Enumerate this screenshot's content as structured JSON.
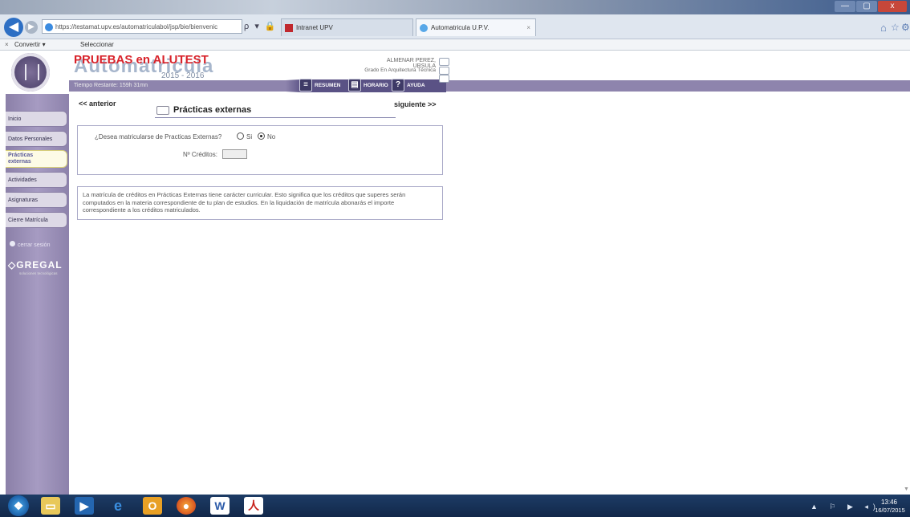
{
  "browser": {
    "url": "https://testamat.upv.es/automatriculabol/jsp/bie/bienvenic",
    "url_actions": "ρ ▾ 🔒 ↻",
    "tabs": [
      {
        "label": "Intranet UPV"
      },
      {
        "label": "Automatricula U.P.V.",
        "close": "×"
      }
    ],
    "command_bar": {
      "close": "×",
      "convert": "Convertir ▾",
      "select": "Seleccionar"
    },
    "window_buttons": {
      "minimize": "—",
      "maximize": "▢",
      "close": "x"
    }
  },
  "header": {
    "brand_top": "PRUEBAS en ALUTEST",
    "brand_back": "Automatricula",
    "year": "2015 - 2016",
    "time_remaining": "Tiempo Restante: 159h 31mn",
    "user_name": "ALMENAR PEREZ, URSULA",
    "user_degree": "Grado En Arquitectura Técnica",
    "buttons": {
      "resumen": "RESUMEN",
      "horario": "HORARIO",
      "ayuda": "AYUDA"
    }
  },
  "sidebar": {
    "items": [
      {
        "label": "Inicio"
      },
      {
        "label": "Datos Personales"
      },
      {
        "label_1": "Prácticas",
        "label_2": "externas"
      },
      {
        "label": "Actividades"
      },
      {
        "label": "Asignaturas"
      },
      {
        "label": "Cierre Matrícula"
      }
    ],
    "logout": "cerrar sesión",
    "partner": "GREGAL",
    "partner_sub": "soluciones tecnológicas"
  },
  "main": {
    "prev": "<< anterior",
    "next": "siguiente >>",
    "title": "Prácticas externas",
    "question": "¿Desea matricularse de Practicas Externas?",
    "option_si": "Si",
    "option_no": "No",
    "selected_option": "No",
    "creditos_label": "Nº Créditos:",
    "creditos_value": "",
    "info_text": "La matrícula de créditos en Prácticas Externas tiene carácter curricular. Esto significa que los créditos que superes serán computados en la materia correspondiente de tu plan de estudios. En la liquidación de matrícula abonarás el importe correspondiente a los créditos matriculados."
  },
  "taskbar": {
    "apps": [
      "start",
      "explorer",
      "media",
      "internet-explorer",
      "outlook",
      "firefox",
      "word",
      "acrobat"
    ],
    "tray_icons": "▲ ⚐ ▶ ◂)",
    "time": "13:46",
    "date": "16/07/2015"
  }
}
